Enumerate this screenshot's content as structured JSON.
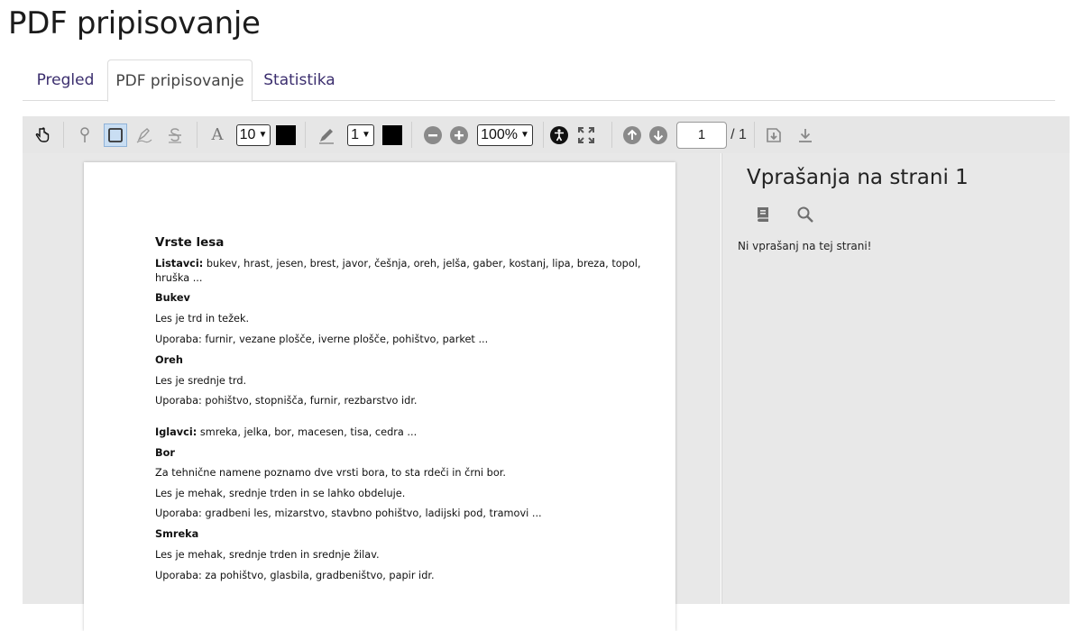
{
  "page_title": "PDF pripisovanje",
  "tabs": [
    {
      "label": "Pregled",
      "active": false
    },
    {
      "label": "PDF pripisovanje",
      "active": true
    },
    {
      "label": "Statistika",
      "active": false
    }
  ],
  "toolbar": {
    "icons": [
      "hand-pointer-icon",
      "map-pin-icon",
      "rectangle-icon",
      "highlighter-icon",
      "strikethrough-icon",
      "text-icon",
      "pencil-icon",
      "zoom-out-icon",
      "zoom-in-icon",
      "accessibility-icon",
      "fullscreen-icon",
      "arrow-up-icon",
      "arrow-down-icon",
      "download-to-device-icon",
      "download-icon"
    ],
    "font_size": "10",
    "text_color": "#000000",
    "line_width": "1",
    "draw_color": "#000000",
    "zoom": "100%",
    "page_current": "1",
    "page_total": "/ 1"
  },
  "document": {
    "lines": [
      {
        "label": "",
        "text": "Vrste lesa"
      },
      {
        "label": "Listavci:",
        "text": " bukev, hrast, jesen, brest, javor, češnja, oreh, jelša, gaber, kostanj, lipa, breza, topol,"
      },
      {
        "label": "",
        "text": "hruška ..."
      },
      {
        "label": "",
        "text": "Bukev"
      },
      {
        "label": "",
        "text": "Les je trd in težek."
      },
      {
        "label": "",
        "text": "Uporaba: furnir, vezane plošče, iverne plošče, pohištvo, parket ..."
      },
      {
        "label": "",
        "text": "Oreh"
      },
      {
        "label": "",
        "text": "Les je srednje trd."
      },
      {
        "label": "",
        "text": "Uporaba: pohištvo, stopnišča, furnir, rezbarstvo idr."
      },
      {
        "label": "Iglavci:",
        "text": " smreka, jelka, bor, macesen, tisa, cedra ..."
      },
      {
        "label": "",
        "text": "Bor"
      },
      {
        "label": "",
        "text": "Za tehnične namene poznamo dve vrsti bora, to sta rdeči in črni bor."
      },
      {
        "label": "",
        "text": "Les je mehak, srednje trden in se lahko obdeluje."
      },
      {
        "label": "",
        "text": "Uporaba: gradbeni les, mizarstvo, stavbno pohištvo, ladijski pod, tramovi ..."
      },
      {
        "label": "",
        "text": "Smreka"
      },
      {
        "label": "",
        "text": "Les je mehak, srednje trden in srednje žilav."
      },
      {
        "label": "",
        "text": "Uporaba: za pohištvo, glasbila, gradbeništvo, papir idr."
      }
    ]
  },
  "sidebar": {
    "title": "Vprašanja na strani 1",
    "icons": [
      "book-icon",
      "search-icon"
    ],
    "empty_message": "Ni vprašanj na tej strani!"
  },
  "colors": {
    "tab_text": "#3b2e6e",
    "toolbar_bg": "#e6e6e6",
    "active_tool_bg": "#c9def3"
  }
}
